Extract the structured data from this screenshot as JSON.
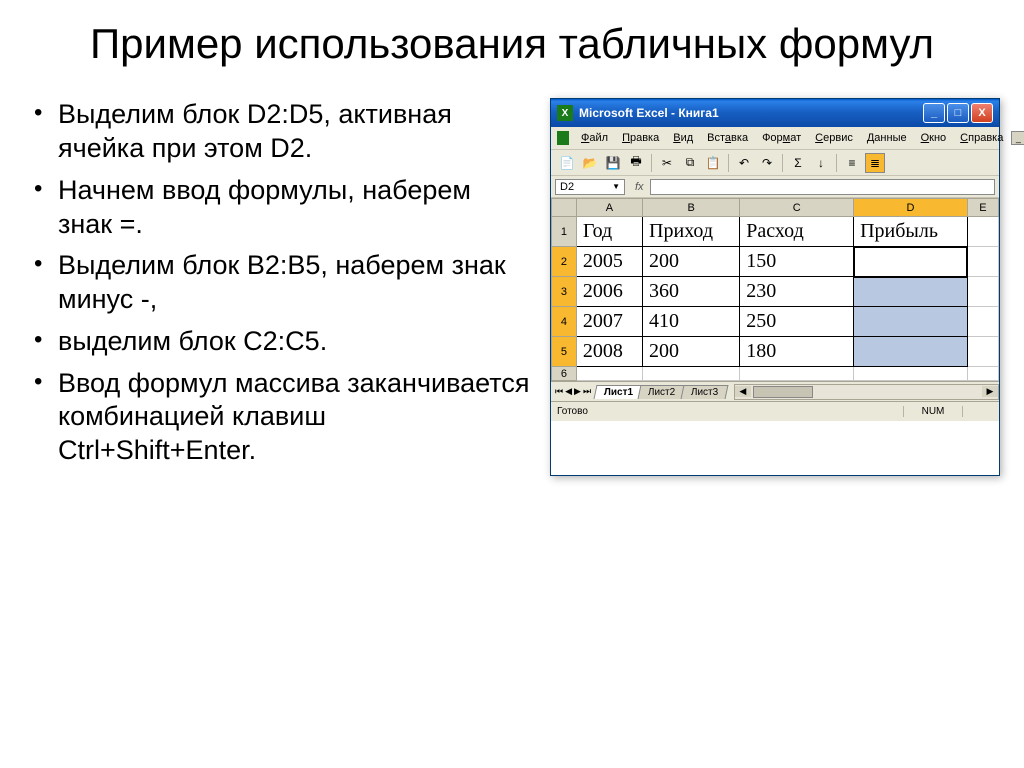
{
  "title": "Пример использования табличных формул",
  "bullets": [
    "Выделим блок D2:D5, активная ячейка при этом D2.",
    "Начнем ввод формулы, наберем знак =.",
    "Выделим блок B2:B5, наберем знак минус -,",
    "выделим блок C2:C5.",
    "Ввод формул массива заканчивается комбинацией клавиш Ctrl+Shift+Enter."
  ],
  "excel": {
    "window_title": "Microsoft Excel - Книга1",
    "menu": [
      "Файл",
      "Правка",
      "Вид",
      "Вставка",
      "Формат",
      "Сервис",
      "Данные",
      "Окно",
      "Справка"
    ],
    "namebox": "D2",
    "fx": "fx",
    "columns": [
      "A",
      "B",
      "C",
      "D",
      "E"
    ],
    "rows": [
      "1",
      "2",
      "3",
      "4",
      "5",
      "6"
    ],
    "headers": {
      "A": "Год",
      "B": "Приход",
      "C": "Расход",
      "D": "Прибыль"
    },
    "data": [
      {
        "A": "2005",
        "B": "200",
        "C": "150"
      },
      {
        "A": "2006",
        "B": "360",
        "C": "230"
      },
      {
        "A": "2007",
        "B": "410",
        "C": "250"
      },
      {
        "A": "2008",
        "B": "200",
        "C": "180"
      }
    ],
    "tabs": [
      "Лист1",
      "Лист2",
      "Лист3"
    ],
    "status_ready": "Готово",
    "status_num": "NUM"
  }
}
